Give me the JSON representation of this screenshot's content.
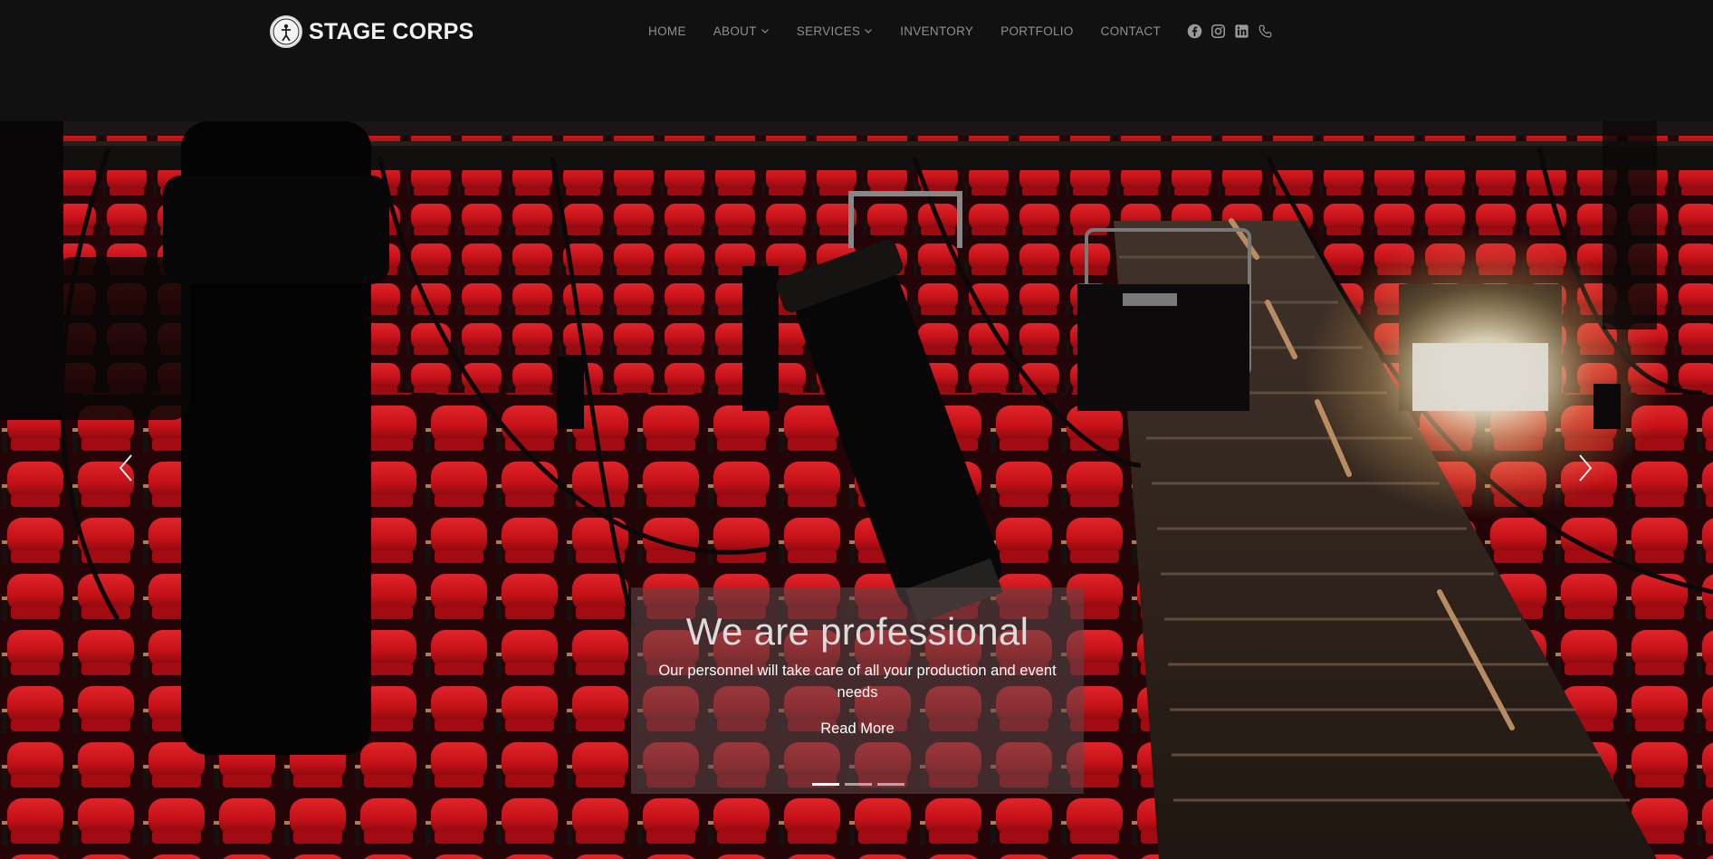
{
  "brand": {
    "name": "STAGE CORPS",
    "logo_icon": "stage-corps-logo-icon"
  },
  "nav": {
    "items": [
      {
        "label": "HOME",
        "has_dropdown": false
      },
      {
        "label": "ABOUT",
        "has_dropdown": true
      },
      {
        "label": "SERVICES",
        "has_dropdown": true
      },
      {
        "label": "INVENTORY",
        "has_dropdown": false
      },
      {
        "label": "PORTFOLIO",
        "has_dropdown": false
      },
      {
        "label": "CONTACT",
        "has_dropdown": false
      }
    ],
    "social_icons": [
      "facebook-icon",
      "instagram-icon",
      "linkedin-icon",
      "phone-icon"
    ]
  },
  "hero": {
    "title": "We are professional",
    "text": "Our personnel will take care of all your production and event needs",
    "button_label": "Read More",
    "slide_count": 3,
    "active_slide": 1
  },
  "colors": {
    "header_bg": "#111111",
    "nav_text": "#8f8f8f",
    "brand_text": "#f2f2f2",
    "seat_red": "#e0141c"
  }
}
